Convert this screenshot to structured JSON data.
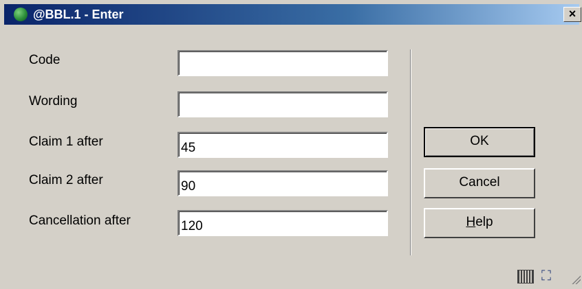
{
  "window": {
    "title": "@BBL.1 - Enter",
    "close_glyph": "×"
  },
  "form": {
    "fields": [
      {
        "label": "Code",
        "value": ""
      },
      {
        "label": "Wording",
        "value": ""
      },
      {
        "label": "Claim 1 after",
        "value": "45"
      },
      {
        "label": "Claim 2 after",
        "value": "90"
      },
      {
        "label": "Cancellation after",
        "value": "120"
      }
    ]
  },
  "buttons": {
    "ok": "OK",
    "cancel": "Cancel",
    "help_mnemonic": "H",
    "help_rest": "elp"
  },
  "status_icons": {
    "keyboard": "keyboard-icon",
    "resize": "maximize-icon",
    "resize_glyph": "⛶"
  }
}
